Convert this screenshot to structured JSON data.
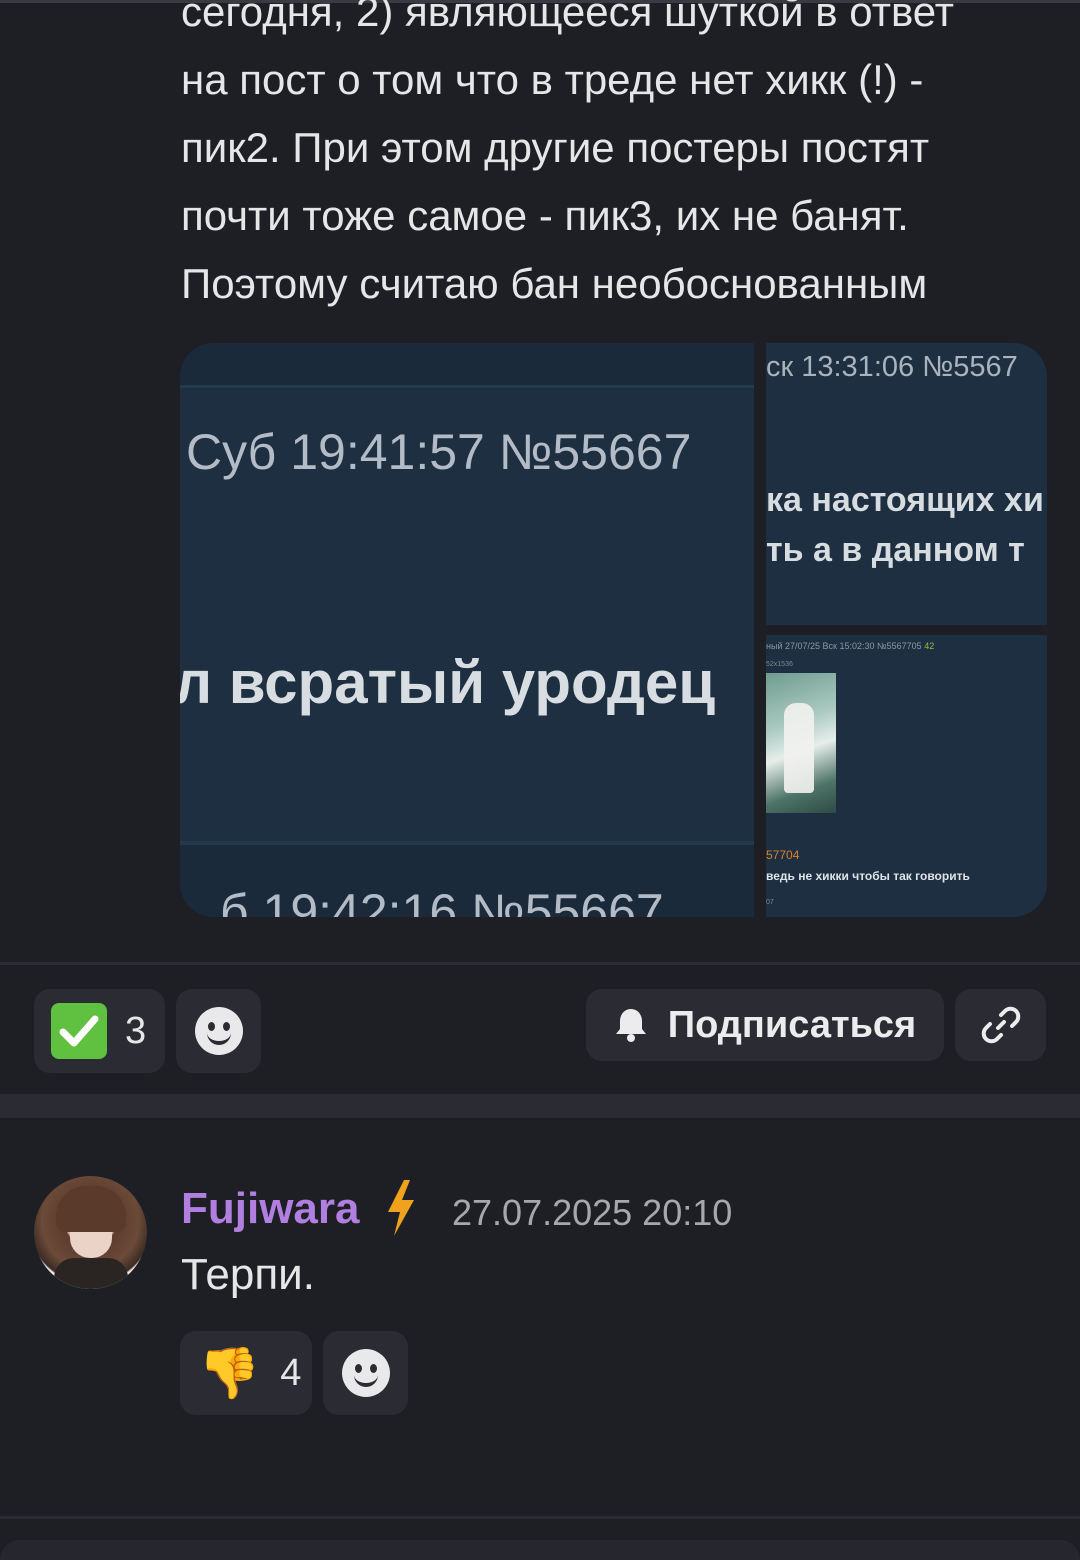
{
  "post": {
    "text": "сегодня, 2) являющееся шуткой в ответ\nна пост о том что в треде нет хикк (!) -\nпик2. При этом другие постеры постят\nпочти тоже самое - пик3, их не банят.\nПоэтому считаю бан необоснованным",
    "images": {
      "main": {
        "line1": "Суб 19:41:57  №55667",
        "line2": "л всратый уродец",
        "line3": "б 19:42:16  №55667"
      },
      "top_right": {
        "line1": "ск 13:31:06  №5567",
        "line2": "ка настоящих хи",
        "line3": "ть а в данном т"
      },
      "bottom_right": {
        "meta": "ный 27/07/25 Вск 15:02:30 №5567705",
        "meta_num": "42",
        "size": "52х1536",
        "reply": "57704",
        "message": "ведь не хикки чтобы так говорить",
        "tiny": "07"
      }
    },
    "reactions": [
      {
        "emoji": "check-mark-icon",
        "count": "3"
      }
    ],
    "subscribe_label": "Подписаться"
  },
  "comment": {
    "username": "Fujiwara",
    "timestamp": "27.07.2025 20:10",
    "text": "Терпи.",
    "reactions": [
      {
        "emoji": "👎",
        "count": "4"
      }
    ]
  },
  "colors": {
    "background": "#1e1f25",
    "button": "#2b2c33",
    "username": "#b07fe0",
    "bolt": "#f0a21e",
    "check": "#5fc13f"
  }
}
